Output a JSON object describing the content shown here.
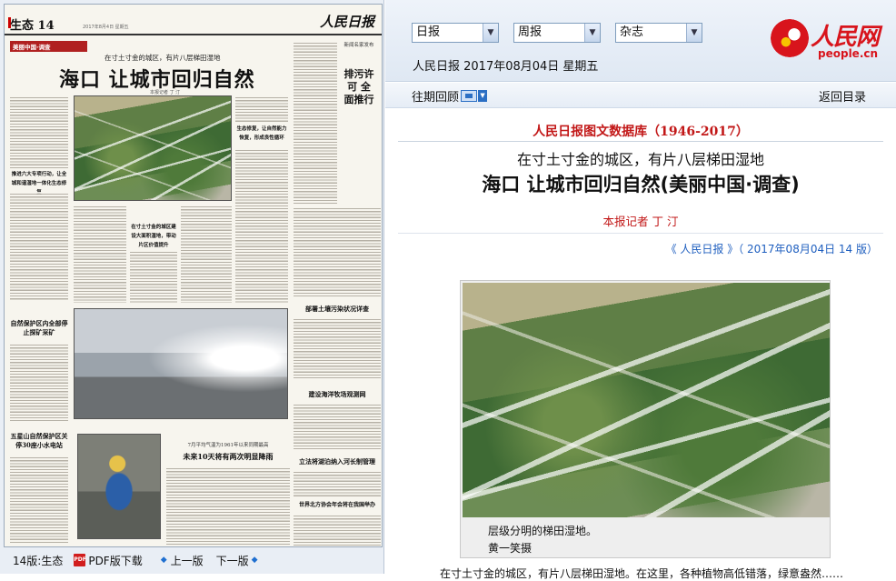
{
  "paper": {
    "section": "生态",
    "page_no": "14",
    "date_line": "2017年8月4日 星期五",
    "logo": "人民日报",
    "column_tag": "美丽中国·调查",
    "subhead": "在寸土寸金的城区，有片八层梯田湿地",
    "headline": "海口  让城市回归自然",
    "byline": "本报记者 丁 汀",
    "side_head_1": "排污许可 全面推行",
    "side_note": "新闻名家发布",
    "box_head_1": "推进六大专项行动，让全城和谐湿地一体化生态修复",
    "box_head_2": "生态修复，让自然能力恢复，形成良性循环",
    "box_head_3": "在寸土寸金的城区建设大面积湿地，带动片区价值提升",
    "right_head_1": "部署土壤污染状况详查",
    "right_head_2": "建设海洋牧场观测网",
    "right_head_3": "立法将湖泊纳入河长制管理",
    "right_head_4": "世界北方协会年会将在我国举办",
    "left_head_1": "自然保护区内全部停止探矿采矿",
    "left_head_2": "五星山自然保护区关停30座小水电站",
    "bottom_kicker": "7月平均气温为1961年以来同期最高",
    "bottom_head": "未来10天将有两次明显降雨"
  },
  "bottombar": {
    "page_label": "14版:生态",
    "pdf_label": "PDF版下载",
    "prev_label": "上一版",
    "next_label": "下一版"
  },
  "topbar": {
    "dropdowns": [
      {
        "value": "日报"
      },
      {
        "value": "周报"
      },
      {
        "value": "杂志"
      }
    ],
    "date_line": "人民日报 2017年08月04日 星期五",
    "logo_text": "人民网",
    "logo_url": "people.cn"
  },
  "navbar": {
    "past_issue": "往期回顾",
    "back": "返回目录"
  },
  "article": {
    "db_title": "人民日报图文数据库（1946-2017）",
    "subtitle": "在寸土寸金的城区，有片八层梯田湿地",
    "title": "海口 让城市回归自然(美丽中国·调查)",
    "author": "本报记者 丁 汀",
    "source": "《 人民日报 》（ 2017年08月04日   14 版）",
    "caption": "层级分明的梯田湿地。",
    "credit": "黄一笑摄",
    "cutoff": "在寸土寸金的城区，有片八层梯田湿地。在这里，各种植物高低错落，绿意盎然……"
  },
  "colors": {
    "accent_red": "#c21818",
    "link_blue": "#1f5fbf",
    "logo_red": "#d8141c"
  }
}
